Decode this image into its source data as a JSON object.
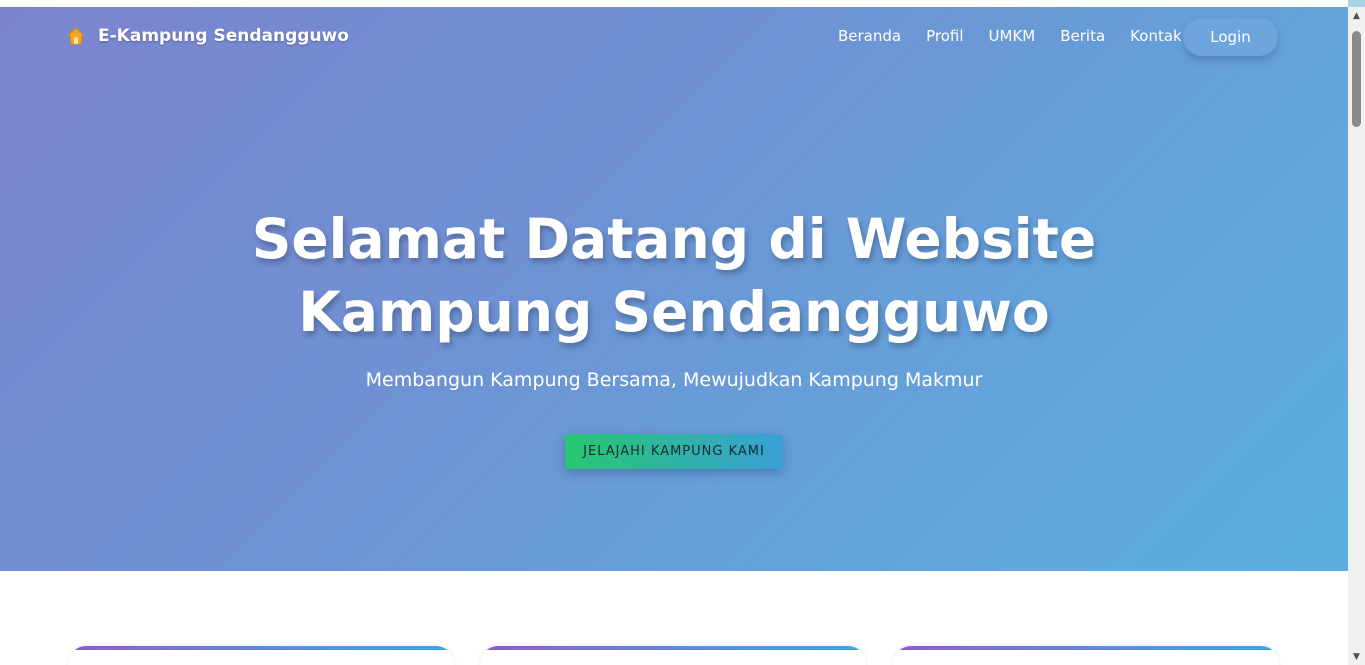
{
  "brand": {
    "name": "E-Kampung Sendangguwo",
    "icon": "home-icon",
    "icon_color": "#f5a623"
  },
  "nav": {
    "links": [
      {
        "label": "Beranda"
      },
      {
        "label": "Profil"
      },
      {
        "label": "UMKM"
      },
      {
        "label": "Berita"
      },
      {
        "label": "Kontak"
      }
    ],
    "login_label": "Login"
  },
  "hero": {
    "title_line1": "Selamat Datang di Website",
    "title_line2": "Kampung Sendangguwo",
    "subtitle": "Membangun Kampung Bersama, Mewujudkan Kampung Makmur",
    "cta_label": "JELAJAHI KAMPUNG KAMI",
    "gradient_start": "#7c84cf",
    "gradient_end": "#5caee0"
  },
  "cta_gradient": {
    "start": "#28c76f",
    "end": "#3a9fd6"
  },
  "scrollbar": {
    "up_icon": "scroll-up-arrow-icon",
    "down_icon": "scroll-down-arrow-icon"
  }
}
